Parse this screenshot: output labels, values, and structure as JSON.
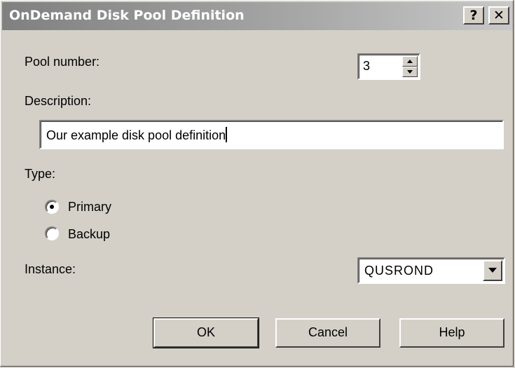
{
  "window": {
    "title": "OnDemand Disk Pool Definition",
    "help_label": "?",
    "close_label": "✕"
  },
  "pool_number": {
    "label": "Pool number:",
    "value": "3"
  },
  "description": {
    "label": "Description:",
    "value": "Our example disk pool definition"
  },
  "type": {
    "label": "Type:",
    "options": [
      {
        "label": "Primary",
        "selected": true
      },
      {
        "label": "Backup",
        "selected": false
      }
    ]
  },
  "instance": {
    "label": "Instance:",
    "value": "QUSROND"
  },
  "buttons": {
    "ok": "OK",
    "cancel": "Cancel",
    "help": "Help"
  }
}
